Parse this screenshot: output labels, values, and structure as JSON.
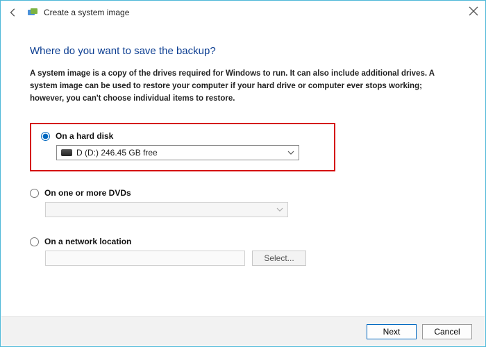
{
  "window": {
    "title": "Create a system image"
  },
  "heading": "Where do you want to save the backup?",
  "description": "A system image is a copy of the drives required for Windows to run. It can also include additional drives. A system image can be used to restore your computer if your hard drive or computer ever stops working; however, you can't choose individual items to restore.",
  "options": {
    "hard_disk": {
      "label": "On a hard disk",
      "selected_drive": "D (D:)  246.45 GB free"
    },
    "dvd": {
      "label": "On one or more DVDs",
      "selected_drive": ""
    },
    "network": {
      "label": "On a network location",
      "path": "",
      "select_btn": "Select..."
    }
  },
  "footer": {
    "next": "Next",
    "cancel": "Cancel"
  }
}
